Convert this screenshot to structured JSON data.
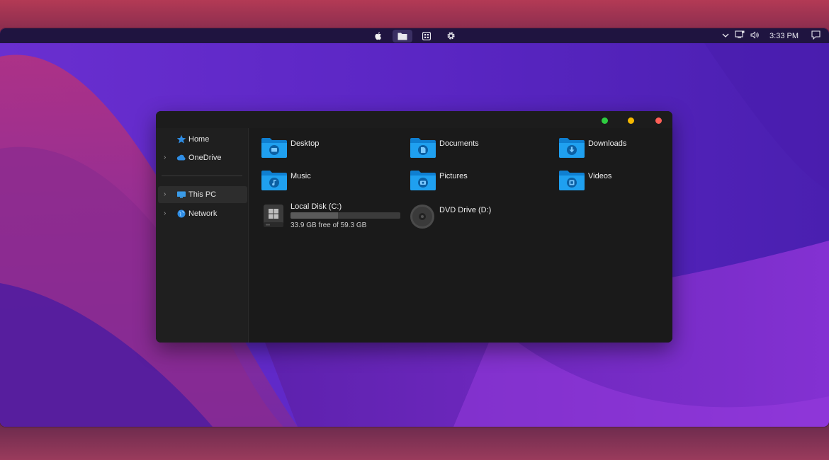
{
  "menubar": {
    "clock": "3:33 PM",
    "icons": [
      "apple-icon",
      "folder-icon",
      "grid-icon",
      "gear-icon",
      "chevron-down-icon",
      "monitor-icon",
      "volume-icon",
      "notification-icon"
    ]
  },
  "window": {
    "traffic_lights": {
      "green": "#2ecc40",
      "yellow": "#f5b800",
      "red": "#ff5f57"
    },
    "sidebar": {
      "items": [
        {
          "label": "Home",
          "icon": "star-icon"
        },
        {
          "label": "OneDrive",
          "icon": "cloud-icon"
        },
        {
          "label": "This PC",
          "icon": "monitor-icon"
        },
        {
          "label": "Network",
          "icon": "globe-icon"
        }
      ]
    },
    "folders": [
      {
        "label": "Desktop",
        "icon": "desktop-glyph-icon"
      },
      {
        "label": "Documents",
        "icon": "document-glyph-icon"
      },
      {
        "label": "Downloads",
        "icon": "download-glyph-icon"
      },
      {
        "label": "Music",
        "icon": "music-glyph-icon"
      },
      {
        "label": "Pictures",
        "icon": "camera-glyph-icon"
      },
      {
        "label": "Videos",
        "icon": "video-glyph-icon"
      }
    ],
    "drives": [
      {
        "label": "Local Disk (C:)",
        "sub": "33.9 GB free of 59.3 GB",
        "used_fraction": 0.43
      },
      {
        "label": "DVD Drive (D:)"
      }
    ]
  },
  "colors": {
    "accent_folder": "#1fa0f0",
    "window_bg": "#1c1c1c",
    "menubar_bg": "#1f1440"
  }
}
